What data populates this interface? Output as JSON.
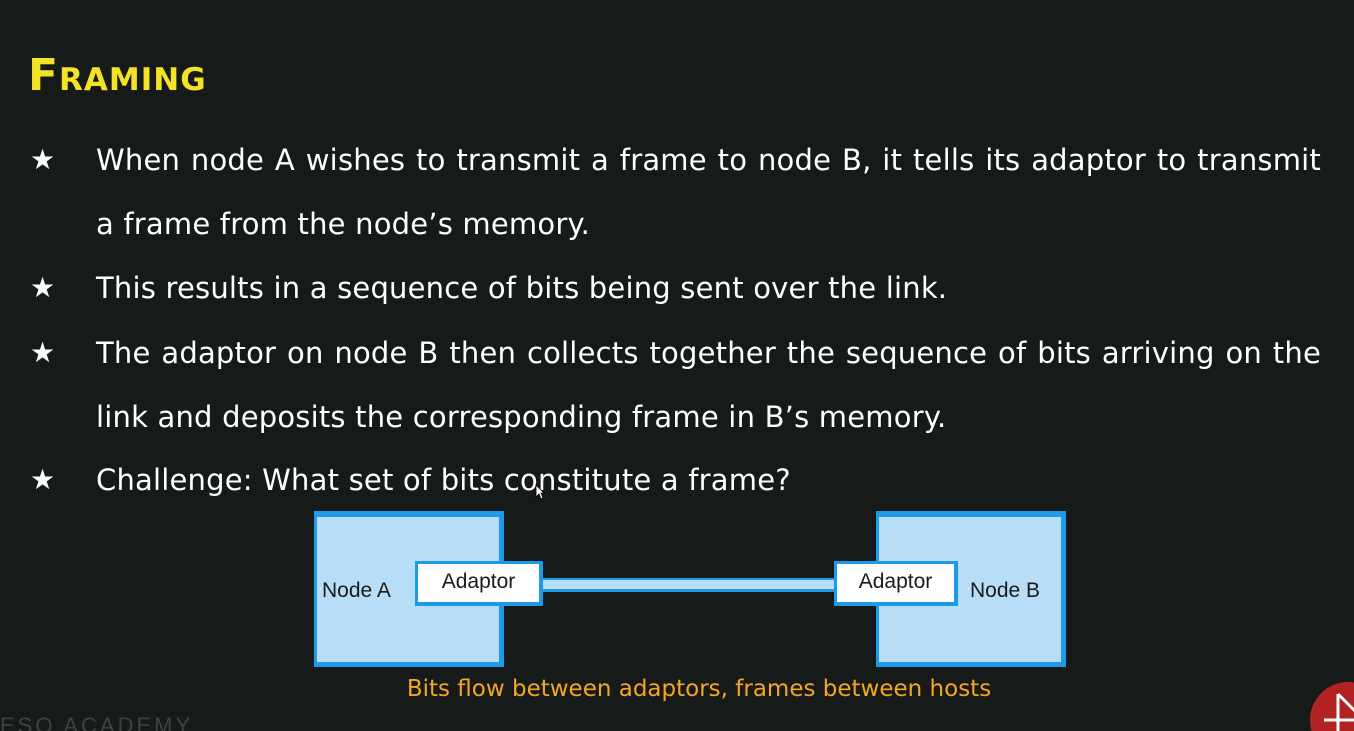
{
  "slide": {
    "title": "Framing",
    "bullets": [
      {
        "star": "★",
        "text": "When node A wishes to transmit a frame to node B, it tells its adaptor to transmit a frame from the node’s memory."
      },
      {
        "star": "★",
        "text": "This results in a sequence of bits being sent over the link."
      },
      {
        "star": "★",
        "text": "The adaptor on node B then collects together the sequence of bits arriving on the link and deposits the corresponding frame in B’s memory."
      },
      {
        "star": "★",
        "text": "Challenge: What set of bits constitute a frame?"
      }
    ]
  },
  "diagram": {
    "node_a_label": "Node A",
    "node_b_label": "Node B",
    "adaptor_a_label": "Adaptor",
    "adaptor_b_label": "Adaptor",
    "caption": "Bits flow between adaptors, frames between hosts"
  },
  "branding": {
    "watermark": "ESO ACADEMY",
    "logo_icon": "neso-academy-logo-icon"
  },
  "colors": {
    "background": "#161b19",
    "title": "#f3e226",
    "text": "#ffffff",
    "caption": "#f5a623",
    "node_fill": "#b7ddf7",
    "node_border": "#1e9be8",
    "logo": "#b22222"
  }
}
